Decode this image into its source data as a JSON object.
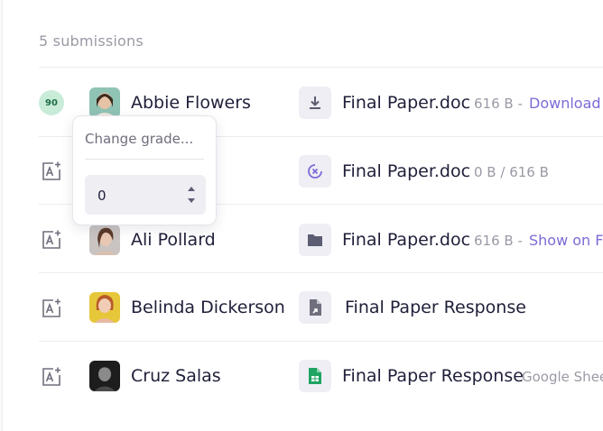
{
  "submissions": {
    "count_label": "5 submissions"
  },
  "popover": {
    "title": "Change grade...",
    "value": "0"
  },
  "rows": [
    {
      "name": "Abbie Flowers",
      "grade": "90",
      "file_name": "Final Paper.doc",
      "file_meta": "616 B -",
      "file_link": "Download",
      "file_icon": "download-icon"
    },
    {
      "name": "",
      "file_name": "Final Paper.doc",
      "file_meta": "0 B / 616 B",
      "file_icon": "cancel-upload-icon"
    },
    {
      "name": "Ali Pollard",
      "file_name": "Final Paper.doc",
      "file_meta": "616 B -",
      "file_link": "Show on Fi",
      "file_icon": "folder-icon"
    },
    {
      "name": "Belinda Dickerson",
      "file_name": "Final Paper Response",
      "file_icon": "shared-document-icon"
    },
    {
      "name": "Cruz Salas",
      "file_name": "Final Paper Response",
      "file_meta": "Google Shee",
      "file_icon": "google-sheets-icon"
    }
  ],
  "colors": {
    "accent": "#7c6bd6",
    "grade_badge_bg": "#c9ecd9",
    "grade_badge_text": "#1e6e46",
    "sheets_green": "#1fa463"
  }
}
